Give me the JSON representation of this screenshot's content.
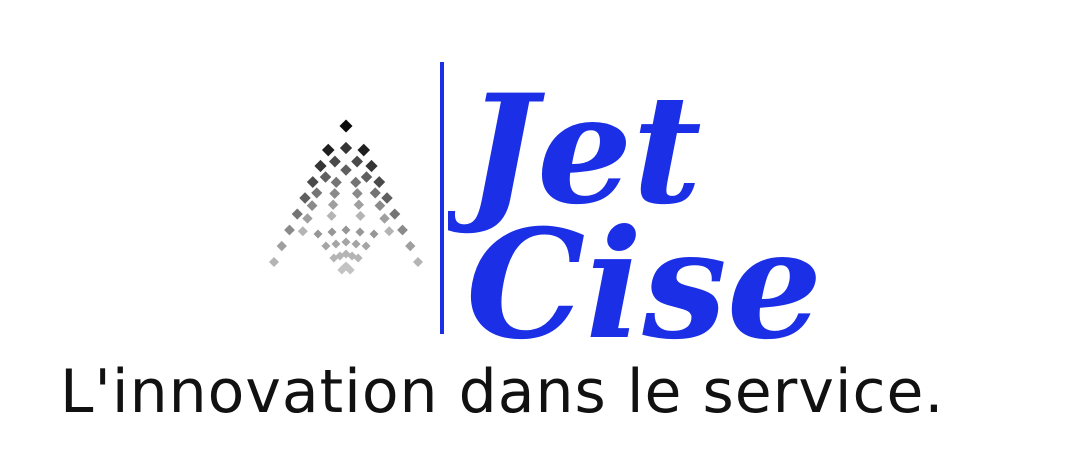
{
  "brand": {
    "name_line1": "Jet",
    "name_line2": "Cise",
    "tagline": "L'innovation dans le service."
  },
  "colors": {
    "brand_blue": "#1a2fe6",
    "tagline_black": "#111111",
    "background": "#ffffff"
  },
  "icons": {
    "emblem": "diamond-fan-emblem-icon"
  }
}
